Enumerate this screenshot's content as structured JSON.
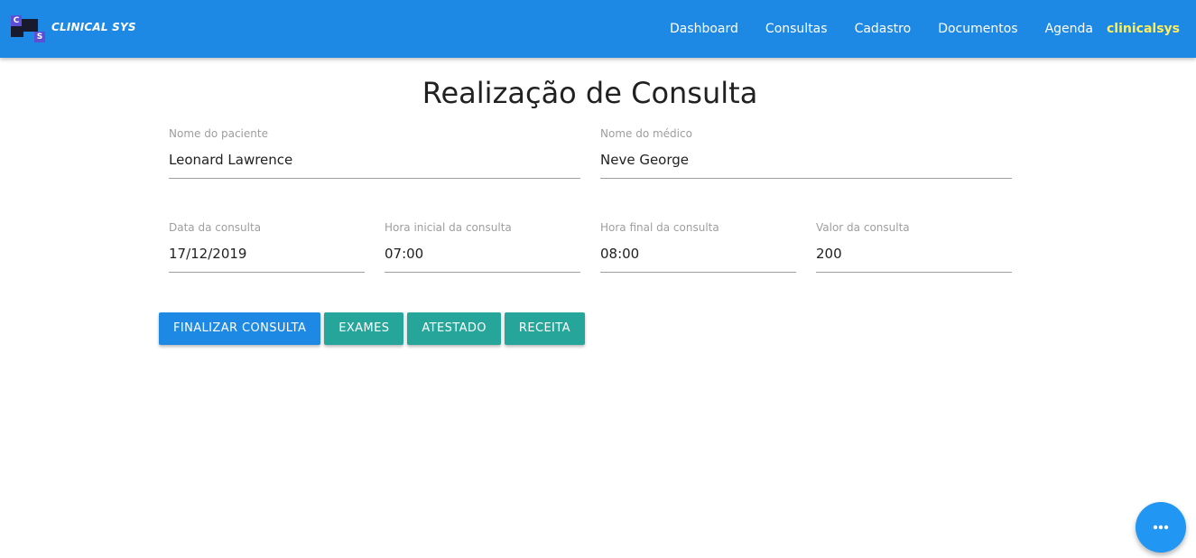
{
  "brand": {
    "logo_letters": [
      "C",
      "S"
    ],
    "name": "CLINICAL SYS"
  },
  "nav": {
    "links": [
      "Dashboard",
      "Consultas",
      "Cadastro",
      "Documentos",
      "Agenda"
    ],
    "user": "clinicalsys"
  },
  "page": {
    "title": "Realização de Consulta"
  },
  "form": {
    "patient": {
      "label": "Nome do paciente",
      "value": "Leonard Lawrence"
    },
    "doctor": {
      "label": "Nome do médico",
      "value": "Neve George"
    },
    "date": {
      "label": "Data da consulta",
      "value": "17/12/2019"
    },
    "start_time": {
      "label": "Hora inicial da consulta",
      "value": "07:00"
    },
    "end_time": {
      "label": "Hora final da consulta",
      "value": "08:00"
    },
    "price": {
      "label": "Valor da consulta",
      "value": "200"
    }
  },
  "actions": {
    "finish": "FINALIZAR CONSULTA",
    "exams": "EXAMES",
    "certificate": "ATESTADO",
    "prescription": "RECEITA"
  },
  "fab": {
    "icon": "more-horiz-icon"
  },
  "colors": {
    "navbar": "#1e88e5",
    "user_highlight": "#ffee58",
    "primary_button": "#1e88e5",
    "secondary_button": "#26a69a",
    "fab": "#2196f3"
  }
}
